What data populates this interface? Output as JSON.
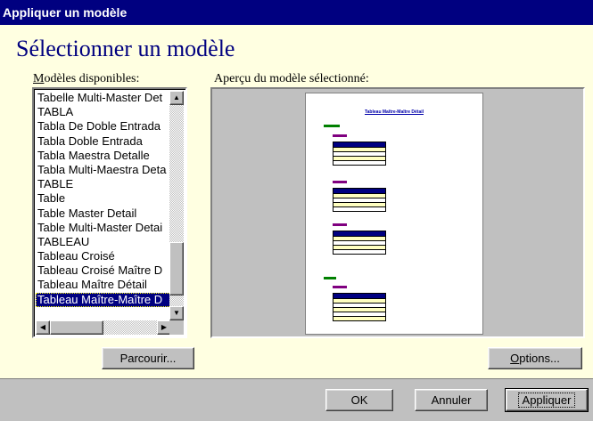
{
  "window": {
    "title": "Appliquer un modèle"
  },
  "heading": "Sélectionner un modèle",
  "models": {
    "label": "Modèles disponibles:",
    "label_accel": "M",
    "label_rest": "odèles disponibles:",
    "items": [
      "Tabelle Multi-Master Det",
      "TABLA",
      "Tabla De Doble Entrada",
      "Tabla Doble Entrada",
      "Tabla Maestra Detalle",
      "Tabla Multi-Maestra Deta",
      "TABLE",
      "Table",
      "Table Master Detail",
      "Table Multi-Master Detai",
      "TABLEAU",
      "Tableau Croisé",
      "Tableau Croisé Maître D",
      "Tableau Maître Détail",
      "Tableau Maître-Maître D"
    ],
    "selected_index": 14
  },
  "preview": {
    "label": "Aperçu du modèle sélectionné:",
    "page_title": "Tableau Maître-Maître Détail"
  },
  "buttons": {
    "browse": "Parcourir...",
    "options_accel": "O",
    "options_rest": "ptions...",
    "ok": "OK",
    "cancel": "Annuler",
    "apply": "Appliquer"
  }
}
